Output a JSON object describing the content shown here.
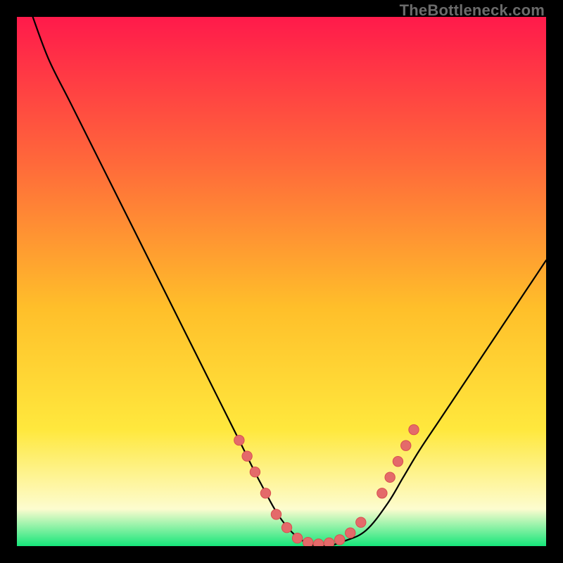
{
  "watermark": "TheBottleneck.com",
  "colors": {
    "background": "#000000",
    "gradient_top": "#ff1a4b",
    "gradient_mid1": "#ff6a3a",
    "gradient_mid2": "#ffbf2a",
    "gradient_mid3": "#ffe83d",
    "gradient_pale": "#fdfccf",
    "gradient_bottom": "#16e67a",
    "curve_stroke": "#000000",
    "dot_fill": "#e46a6a",
    "dot_stroke": "#d84f4f"
  },
  "chart_data": {
    "type": "line",
    "title": "",
    "xlabel": "",
    "ylabel": "",
    "xlim": [
      0,
      100
    ],
    "ylim": [
      0,
      100
    ],
    "series": [
      {
        "name": "bottleneck-curve",
        "x": [
          3,
          6,
          10,
          14,
          18,
          22,
          26,
          30,
          34,
          38,
          42,
          46,
          50,
          54,
          58,
          62,
          66,
          70,
          73,
          76,
          80,
          84,
          88,
          92,
          96,
          100
        ],
        "values": [
          100,
          92,
          84,
          76,
          68,
          60,
          52,
          44,
          36,
          28,
          20,
          12,
          5,
          1,
          0,
          1,
          3,
          8,
          13,
          18,
          24,
          30,
          36,
          42,
          48,
          54
        ]
      }
    ],
    "dots": {
      "name": "highlight-dots",
      "points": [
        {
          "x": 42,
          "y": 20
        },
        {
          "x": 43.5,
          "y": 17
        },
        {
          "x": 45,
          "y": 14
        },
        {
          "x": 47,
          "y": 10
        },
        {
          "x": 49,
          "y": 6
        },
        {
          "x": 51,
          "y": 3.5
        },
        {
          "x": 53,
          "y": 1.5
        },
        {
          "x": 55,
          "y": 0.7
        },
        {
          "x": 57,
          "y": 0.4
        },
        {
          "x": 59,
          "y": 0.6
        },
        {
          "x": 61,
          "y": 1.2
        },
        {
          "x": 63,
          "y": 2.5
        },
        {
          "x": 65,
          "y": 4.5
        },
        {
          "x": 69,
          "y": 10
        },
        {
          "x": 70.5,
          "y": 13
        },
        {
          "x": 72,
          "y": 16
        },
        {
          "x": 73.5,
          "y": 19
        },
        {
          "x": 75,
          "y": 22
        }
      ]
    }
  }
}
